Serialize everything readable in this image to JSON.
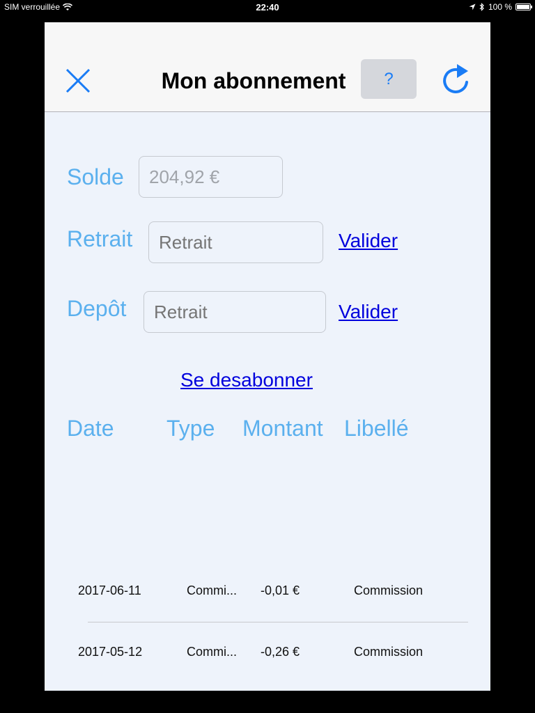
{
  "status_bar": {
    "carrier": "SIM verrouillée",
    "time": "22:40",
    "battery": "100 %"
  },
  "nav": {
    "title": "Mon abonnement",
    "help_label": "?"
  },
  "form": {
    "solde_label": "Solde",
    "solde_value": "204,92 €",
    "retrait_label": "Retrait",
    "retrait_placeholder": "Retrait",
    "depot_label": "Depôt",
    "depot_placeholder": "Retrait",
    "validate_label": "Valider",
    "unsubscribe_label": "Se desabonner"
  },
  "table": {
    "headers": [
      "Date",
      "Type",
      "Montant",
      "Libellé"
    ],
    "rows": [
      {
        "date": "2017-06-11",
        "type": "Commi...",
        "amount": "-0,01 €",
        "label": "Commission"
      },
      {
        "date": "2017-05-12",
        "type": "Commi...",
        "amount": "-0,26 €",
        "label": "Commission"
      }
    ]
  },
  "colors": {
    "accent": "#1a7cf5",
    "label": "#5bb0ee",
    "link": "#0000dd",
    "background": "#eef3fb"
  }
}
